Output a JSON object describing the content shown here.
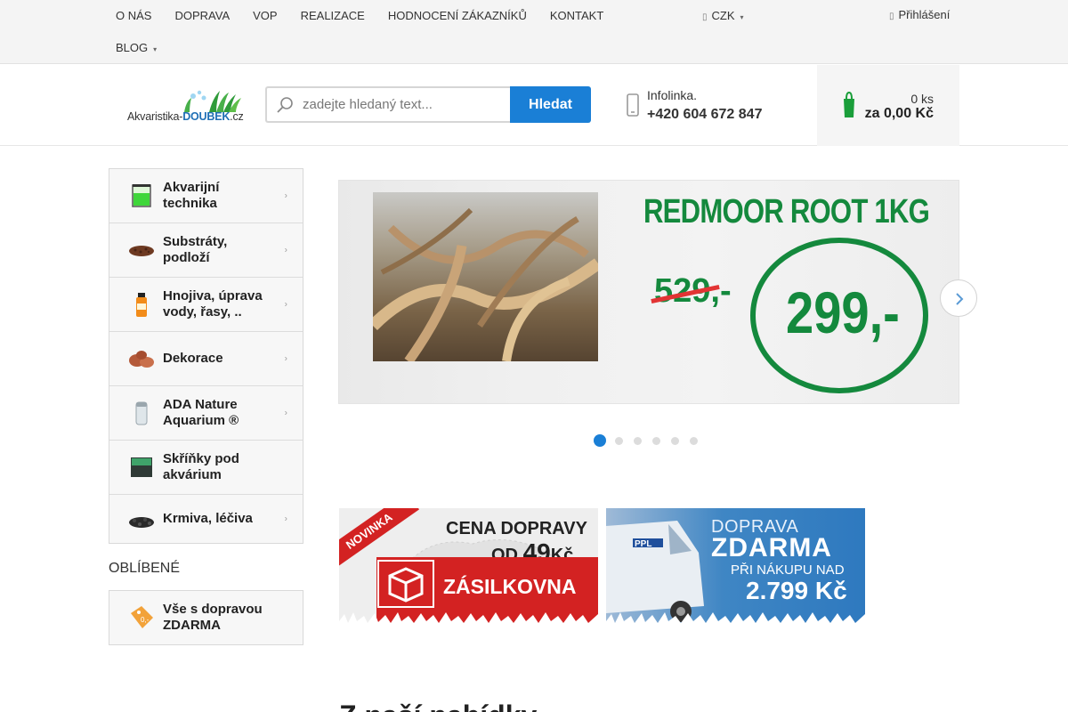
{
  "topnav": {
    "items": [
      "O NÁS",
      "DOPRAVA",
      "VOP",
      "REALIZACE",
      "HODNOCENÍ ZÁKAZNÍKŮ",
      "KONTAKT"
    ],
    "blog": "BLOG",
    "currency": "CZK",
    "login": "Přihlášení"
  },
  "header": {
    "logo_prefix": "Akvaristika-",
    "logo_brand": "DOUBEK",
    "logo_suffix": ".cz",
    "search_placeholder": "zadejte hledaný text...",
    "search_button": "Hledat",
    "info_label": "Infolinka.",
    "info_phone": "+420 604 672 847",
    "cart_count": "0 ks",
    "cart_total": "za 0,00 Kč"
  },
  "sidebar": {
    "categories": [
      {
        "label": "Akvarijní technika",
        "has_arrow": true
      },
      {
        "label": "Substráty, podloží",
        "has_arrow": true
      },
      {
        "label": "Hnojiva, úprava vody, řasy, ..",
        "has_arrow": true
      },
      {
        "label": "Dekorace",
        "has_arrow": true
      },
      {
        "label": "ADA Nature Aquarium ®",
        "has_arrow": true
      },
      {
        "label": "Skříňky pod akvárium",
        "has_arrow": false
      },
      {
        "label": "Krmiva, léčiva",
        "has_arrow": true
      }
    ],
    "favorites_title": "OBLÍBENÉ",
    "favorite_item": "Vše s dopravou ZDARMA"
  },
  "slider": {
    "title": "REDMOOR ROOT 1KG",
    "old_price": "529,-",
    "new_price": "299,-",
    "dot_count": 6,
    "active_dot": 0
  },
  "banners": {
    "zasilkovna": {
      "ribbon": "NOVINKA",
      "line1": "CENA DOPRAVY",
      "line2_prefix": "OD ",
      "line2_number": "49",
      "line2_suffix": "Kč",
      "brand": "ZÁSILKOVNA"
    },
    "ppl": {
      "line1": "DOPRAVA",
      "line2": "ZDARMA",
      "line3": "PŘI NÁKUPU NAD",
      "line4": "2.799 Kč"
    }
  },
  "section": {
    "title": "Z naší nabídky"
  },
  "colors": {
    "primary": "#1a7fd6",
    "green": "#14893d",
    "red": "#d32222"
  }
}
